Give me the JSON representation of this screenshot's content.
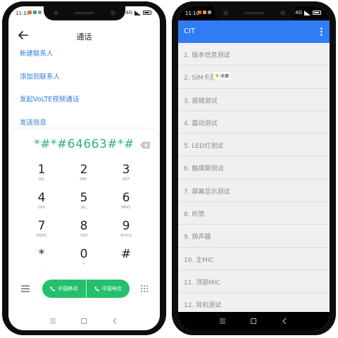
{
  "colors": {
    "accent_green": "#25c06d",
    "dialed_text": "#2bb673",
    "link_blue": "#2e7bd8",
    "appbar_blue": "#2f7cf5",
    "list_text": "#8a8a8a"
  },
  "left_phone": {
    "status": {
      "time": "11:10",
      "network": "4G"
    },
    "header": {
      "title": "通话"
    },
    "options": [
      "新建联系人",
      "添加到联系人",
      "发起VoLTE视频通话",
      "发送信息"
    ],
    "dialed_number": "*#*#64663#*#",
    "keys": [
      {
        "digit": "1",
        "letters": "QD"
      },
      {
        "digit": "2",
        "letters": "ABC"
      },
      {
        "digit": "3",
        "letters": "DEF"
      },
      {
        "digit": "4",
        "letters": "GHI"
      },
      {
        "digit": "5",
        "letters": "JKL"
      },
      {
        "digit": "6",
        "letters": "MNO"
      },
      {
        "digit": "7",
        "letters": "PQRS"
      },
      {
        "digit": "8",
        "letters": "TUV"
      },
      {
        "digit": "9",
        "letters": "WXYZ"
      },
      {
        "digit": "*",
        "letters": ","
      },
      {
        "digit": "0",
        "letters": "+"
      },
      {
        "digit": "#",
        "letters": ""
      }
    ],
    "call_buttons": {
      "sim1": "中国移动",
      "sim2": "中国电信"
    }
  },
  "right_phone": {
    "status": {
      "time": "11:10",
      "network": "4G"
    },
    "appbar": {
      "title": "CIT"
    },
    "items": [
      "1. 版本信息测试",
      "2. SIM卡测",
      "3. 按键测试",
      "4. 震动测试",
      "5. LED灯测试",
      "6. 触摸屏测试",
      "7. 屏幕显示测试",
      "8. 听筒",
      "9. 扬声器",
      "10. 主MIC",
      "11. 顶部MIC",
      "12. 耳机测试"
    ],
    "fav_badge": "收藏"
  }
}
